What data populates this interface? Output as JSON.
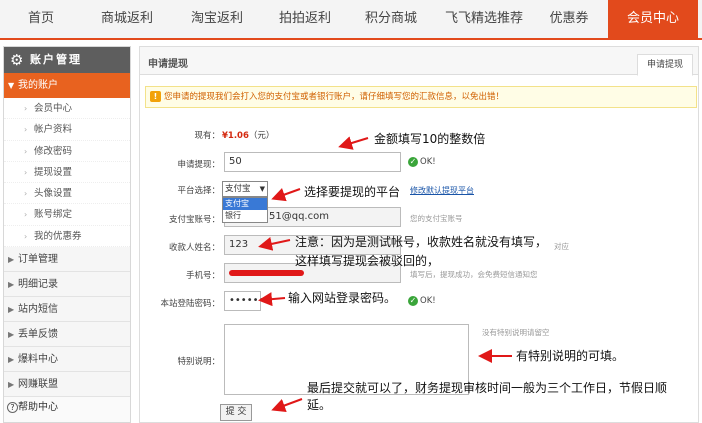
{
  "nav": {
    "items": [
      "首页",
      "商城返利",
      "淘宝返利",
      "拍拍返利",
      "积分商城",
      "飞飞精选推荐",
      "优惠券",
      "会员中心"
    ],
    "active": "会员中心"
  },
  "sidebar": {
    "header": "账户管理",
    "my_account": "我的账户",
    "sub_items": [
      "会员中心",
      "帐户资料",
      "修改密码",
      "提现设置",
      "头像设置",
      "账号绑定",
      "我的优惠券"
    ],
    "categories": [
      "订单管理",
      "明细记录",
      "站内短信",
      "丢单反馈",
      "爆料中心",
      "网赚联盟"
    ],
    "help": "帮助中心"
  },
  "main": {
    "title": "申请提现",
    "tab": "申请提现",
    "notice": "您申请的提现我们会打入您的支付宝或者银行账户，请仔细填写您的汇款信息，以免出错！",
    "balance_label": "现有：",
    "balance_value": "¥1.06",
    "balance_unit": "（元）",
    "fields": {
      "amount_label": "申请提现：",
      "amount_value": "50",
      "platform_label": "平台选择：",
      "platform_value": "支付宝",
      "platform_options": [
        "支付宝",
        "银行"
      ],
      "platform_link": "修改默认提现平台",
      "account_label": "支付宝账号：",
      "account_value": "51@qq.com",
      "account_hint": "您的支付宝账号",
      "name_label": "收款人姓名：",
      "name_value": "123",
      "name_hint": "对应",
      "phone_label": "手机号：",
      "phone_hint": "填写后，提现成功，会免费短信通知您",
      "password_label": "本站登陆密码：",
      "password_value": "••••••",
      "note_label": "特别说明：",
      "note_hint": "没有特别说明请留空",
      "ok_text": "OK!",
      "submit": "提 交"
    }
  },
  "annotations": {
    "amount": "金额填写10的整数倍",
    "platform": "选择要提现的平台",
    "name_line1": "注意：因为是测试帐号，收款姓名就没有填写，",
    "name_line2": "这样填写提现会被驳回的，",
    "password": "输入网站登录密码。",
    "note": "有特别说明的可填。",
    "submit_line1": "最后提交就可以了，财务提现审核时间一般为三个工作日，节假日顺",
    "submit_line2": "延。"
  },
  "colors": {
    "accent": "#e24a1c",
    "annotation_arrow": "#e01818",
    "ok": "#3aa53a"
  }
}
